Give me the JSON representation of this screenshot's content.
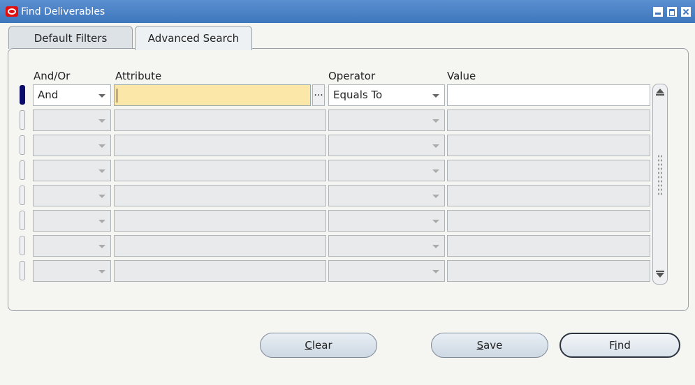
{
  "window": {
    "title": "Find Deliverables"
  },
  "tabs": [
    {
      "label": "Default Filters"
    },
    {
      "label": "Advanced Search"
    }
  ],
  "headers": {
    "and_or": "And/Or",
    "attribute": "Attribute",
    "operator": "Operator",
    "value": "Value"
  },
  "rows": [
    {
      "and_or": "And",
      "attribute": "",
      "operator": "Equals To",
      "value": ""
    },
    {
      "and_or": "",
      "attribute": "",
      "operator": "",
      "value": ""
    },
    {
      "and_or": "",
      "attribute": "",
      "operator": "",
      "value": ""
    },
    {
      "and_or": "",
      "attribute": "",
      "operator": "",
      "value": ""
    },
    {
      "and_or": "",
      "attribute": "",
      "operator": "",
      "value": ""
    },
    {
      "and_or": "",
      "attribute": "",
      "operator": "",
      "value": ""
    },
    {
      "and_or": "",
      "attribute": "",
      "operator": "",
      "value": ""
    },
    {
      "and_or": "",
      "attribute": "",
      "operator": "",
      "value": ""
    }
  ],
  "lov_button_label": "...",
  "buttons": {
    "clear": {
      "mnemonic": "C",
      "rest": "lear"
    },
    "save": {
      "mnemonic": "S",
      "rest": "ave"
    },
    "find": {
      "pre": "F",
      "mnemonic": "i",
      "rest": "nd"
    }
  },
  "colors": {
    "titlebar": "#3f77bd",
    "active_field": "#fbe8a8",
    "record_indicator": "#0a0a6a"
  }
}
